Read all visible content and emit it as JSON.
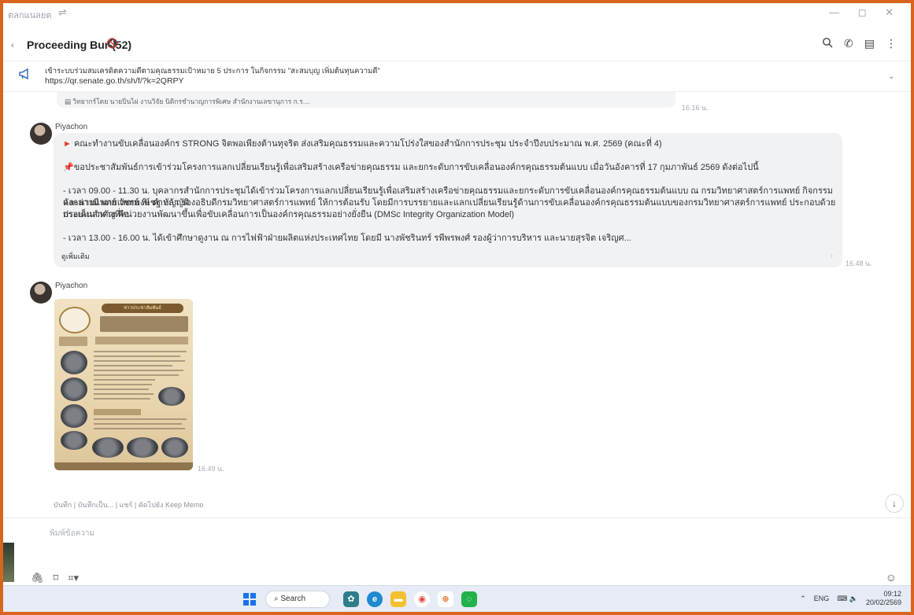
{
  "titlebar": {
    "app_label": "ตลกแนลยต",
    "menu_icon": "sliders-icon",
    "window_controls": "— ◻ ✕"
  },
  "header": {
    "back_glyph": "‹",
    "title": "Proceeding Bur (52)",
    "mute_glyph": "🔇 ◌"
  },
  "announcement": {
    "text": "เข้าระบบร่วมสมเครดิตความดีตามคุณธรรมเป้าหมาย 5 ประการ ในกิจกรรม \"สะสมบุญ เพิ่มต้นทุนความดี\"",
    "url": "https://qr.senate.go.th/sh/f/?k=2QRPY"
  },
  "quoted": {
    "text": "▤ วิทยากร์โดย นายปิ่นไผ่ งานวิจัย นิติกรชำนาญการพิเศษ สำนักงานเลขานุการ ก.ร....",
    "time": "16.16 น."
  },
  "messages": [
    {
      "sender": "Piyachon",
      "lines": [
        "คณะทำงานขับเคลื่อนองค์กร STRONG จิตพอเพียงต้านทุจริต ส่งเสริมคุณธรรมและความโปร่งใสของสำนักการประชุม ประจำปีงบประมาณ พ.ศ. 2569 (คณะที่ 4)",
        "ขอประชาสัมพันธ์การเข้าร่วมโครงการแลกเปลี่ยนเรียนรู้เพื่อเสริมสร้างเครือข่ายคุณธรรม และยกระดับการขับเคลื่อนองค์กรคุณธรรมต้นแบบ เมื่อวันอังคารที่ 17 กุมภาพันธ์ 2569 ดังต่อไปนี้",
        "- เวลา 09.00 - 11.30 น. บุคลากรสำนักการประชุมได้เข้าร่วมโครงการแลกเปลี่ยนเรียนรู้เพื่อเสริมสร้างเครือข่ายคุณธรรมและยกระดับการขับเคลื่อนองค์กรคุณธรรมต้นแบบ ณ กรมวิทยาศาสตร์การแพทย์ กิจกรรมดังกล่าวมี นายแพทย์ พิเชฐ บัญญัติ",
        "และนายแพทย์ วัชรพงษ์ คำหล้า รองอธิบดีกรมวิทยาศาสตร์การแพทย์ ให้การต้อนรับ โดยมีการบรรยายและแลกเปลี่ยนเรียนรู้ด้านการขับเคลื่อนองค์กรคุณธรรมต้นแบบของกรมวิทยาศาสตร์การแพทย์ ประกอบด้วยประเด็นสำคัญ คือ",
        "กรอบแนวทางที่หน่วยงานพัฒนาขึ้นเพื่อขับเคลื่อนการเป็นองค์กรคุณธรรมอย่างยั่งยืน (DMSc Integrity Organization Model)",
        "- เวลา 13.00 - 16.00 น. ได้เข้าศึกษาดูงาน ณ การไฟฟ้าฝ่ายผลิตแห่งประเทศไทย โดยมี นางพัชรินทร์ รพีพรพงศ์ รองผู้ว่าการบริหาร และนายสุรจิต เจริญศ..."
      ],
      "more_label": "ดูเพิ่มเติม",
      "time": "16.48 น."
    },
    {
      "sender": "Piyachon",
      "poster_title": "ข่าวประชาสัมพันธ์",
      "time": "16.49 น."
    }
  ],
  "actions": "บันทึก | บันทึกเป็น... | แชร์ | คัดไปยัง Keep Memo",
  "composer": {
    "placeholder": "พิมพ์ข้อความ"
  },
  "taskbar": {
    "search_label": "Search",
    "tray_lang": "ENG",
    "time": "09:12",
    "date": "20/02/2569"
  },
  "colors": {
    "frame": "#d9641e",
    "accent": "#1e5eb3",
    "flag_red": "#e33b2e",
    "pin_red": "#d8332a"
  }
}
